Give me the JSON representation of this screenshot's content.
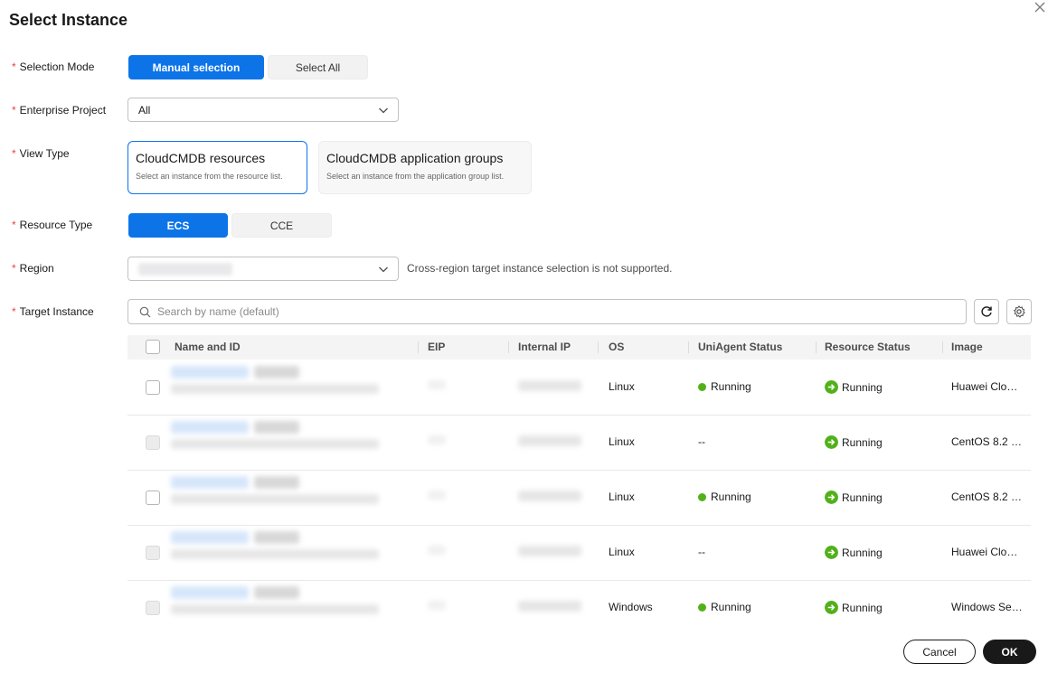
{
  "dialog": {
    "title": "Select Instance"
  },
  "labels": {
    "selection_mode": "Selection Mode",
    "enterprise_project": "Enterprise Project",
    "view_type": "View Type",
    "resource_type": "Resource Type",
    "region": "Region",
    "target_instance": "Target Instance"
  },
  "selection_mode": {
    "manual": "Manual selection",
    "all": "Select All",
    "selected": "manual"
  },
  "enterprise_project": {
    "value": "All"
  },
  "view_type": {
    "resources": {
      "title": "CloudCMDB resources",
      "desc": "Select an instance from the resource list."
    },
    "groups": {
      "title": "CloudCMDB application groups",
      "desc": "Select an instance from the application group list."
    },
    "selected": "resources"
  },
  "resource_type": {
    "ecs": "ECS",
    "cce": "CCE",
    "selected": "ecs"
  },
  "region": {
    "hint": "Cross-region target instance selection is not supported."
  },
  "search": {
    "placeholder": "Search by name (default)"
  },
  "table": {
    "columns": [
      "Name and ID",
      "EIP",
      "Internal IP",
      "OS",
      "UniAgent Status",
      "Resource Status",
      "Image"
    ],
    "rows": [
      {
        "os": "Linux",
        "uniagent": "Running",
        "uniagent_running": true,
        "resource": "Running",
        "image": "Huawei Clo…",
        "disabled": false
      },
      {
        "os": "Linux",
        "uniagent": "--",
        "uniagent_running": false,
        "resource": "Running",
        "image": "CentOS 8.2 …",
        "disabled": true
      },
      {
        "os": "Linux",
        "uniagent": "Running",
        "uniagent_running": true,
        "resource": "Running",
        "image": "CentOS 8.2 …",
        "disabled": false
      },
      {
        "os": "Linux",
        "uniagent": "--",
        "uniagent_running": false,
        "resource": "Running",
        "image": "Huawei Clo…",
        "disabled": true
      },
      {
        "os": "Windows",
        "uniagent": "Running",
        "uniagent_running": true,
        "resource": "Running",
        "image": "Windows Se…",
        "disabled": true
      }
    ]
  },
  "footer": {
    "cancel": "Cancel",
    "ok": "OK"
  },
  "colors": {
    "primary": "#0d74e8",
    "required": "#e54545",
    "running_dot": "#52b11a",
    "running_icon": "#52b11a",
    "dark_button": "#191919"
  },
  "icons": {
    "close": "close-icon",
    "chevron": "chevron-down-icon",
    "search": "search-icon",
    "refresh": "refresh-icon",
    "settings": "gear-icon",
    "resource_running": "arrow-right-circle-icon"
  }
}
